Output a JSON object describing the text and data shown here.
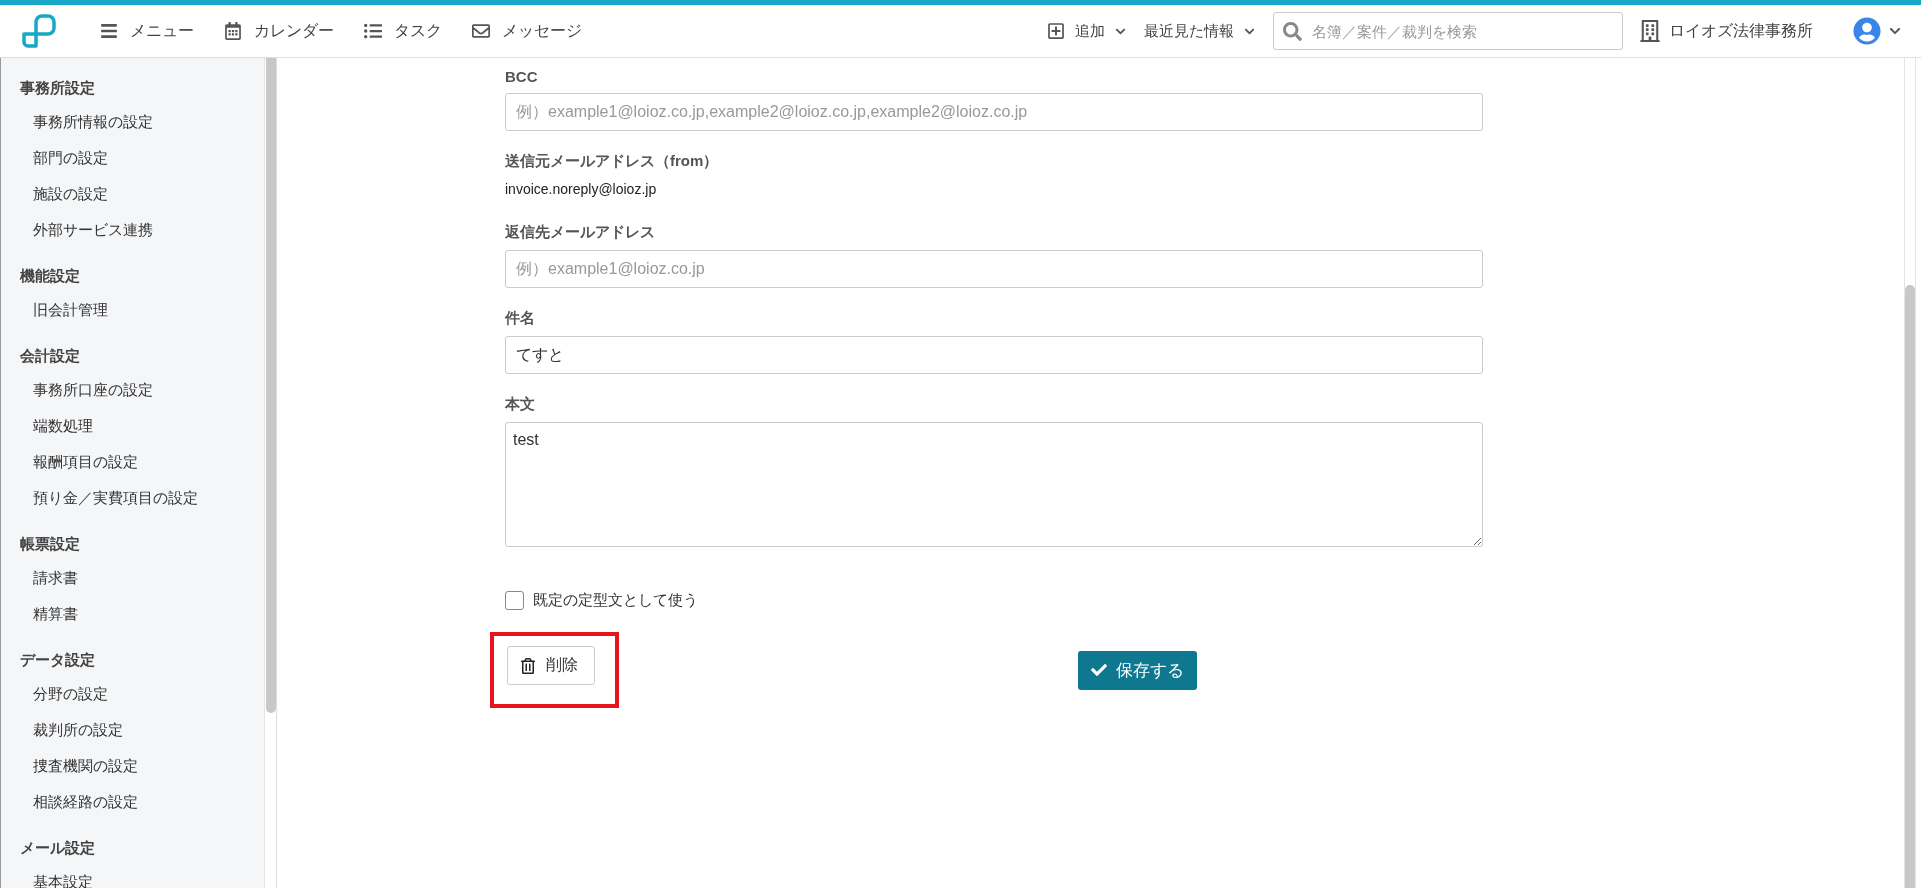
{
  "header": {
    "nav": [
      {
        "kind": "menu",
        "label": "メニュー"
      },
      {
        "kind": "calendar",
        "label": "カレンダー"
      },
      {
        "kind": "tasks",
        "label": "タスク"
      },
      {
        "kind": "mail",
        "label": "メッセージ"
      }
    ],
    "add": {
      "label": "追加"
    },
    "recent": {
      "label": "最近見た情報"
    },
    "search": {
      "placeholder": "名簿／案件／裁判を検索"
    },
    "office": {
      "label": "ロイオズ法律事務所"
    }
  },
  "sidebar": {
    "sections": [
      {
        "title": "事務所設定",
        "items": [
          "事務所情報の設定",
          "部門の設定",
          "施設の設定",
          "外部サービス連携"
        ]
      },
      {
        "title": "機能設定",
        "items": [
          "旧会計管理"
        ]
      },
      {
        "title": "会計設定",
        "items": [
          "事務所口座の設定",
          "端数処理",
          "報酬項目の設定",
          "預り金／実費項目の設定"
        ]
      },
      {
        "title": "帳票設定",
        "items": [
          "請求書",
          "精算書"
        ]
      },
      {
        "title": "データ設定",
        "items": [
          "分野の設定",
          "裁判所の設定",
          "捜査機関の設定",
          "相談経路の設定"
        ]
      },
      {
        "title": "メール設定",
        "items": [
          "基本設定"
        ]
      }
    ]
  },
  "form": {
    "fields": [
      {
        "kind": "input",
        "label": "BCC",
        "placeholder": "例）example1@loioz.co.jp,example2@loioz.co.jp,example2@loioz.co.jp"
      },
      {
        "kind": "static",
        "label": "送信元メールアドレス（from）",
        "value": "invoice.noreply@loioz.jp"
      },
      {
        "kind": "input",
        "label": "返信先メールアドレス",
        "placeholder": "例）example1@loioz.co.jp"
      },
      {
        "kind": "input",
        "label": "件名",
        "value": "てすと"
      },
      {
        "kind": "textarea",
        "label": "本文",
        "value": "test"
      }
    ],
    "default_checkbox": {
      "label": "既定の定型文として使う",
      "checked": false
    },
    "delete_button": {
      "label": "削除",
      "highlighted": true
    },
    "save_button": {
      "label": "保存する"
    }
  }
}
